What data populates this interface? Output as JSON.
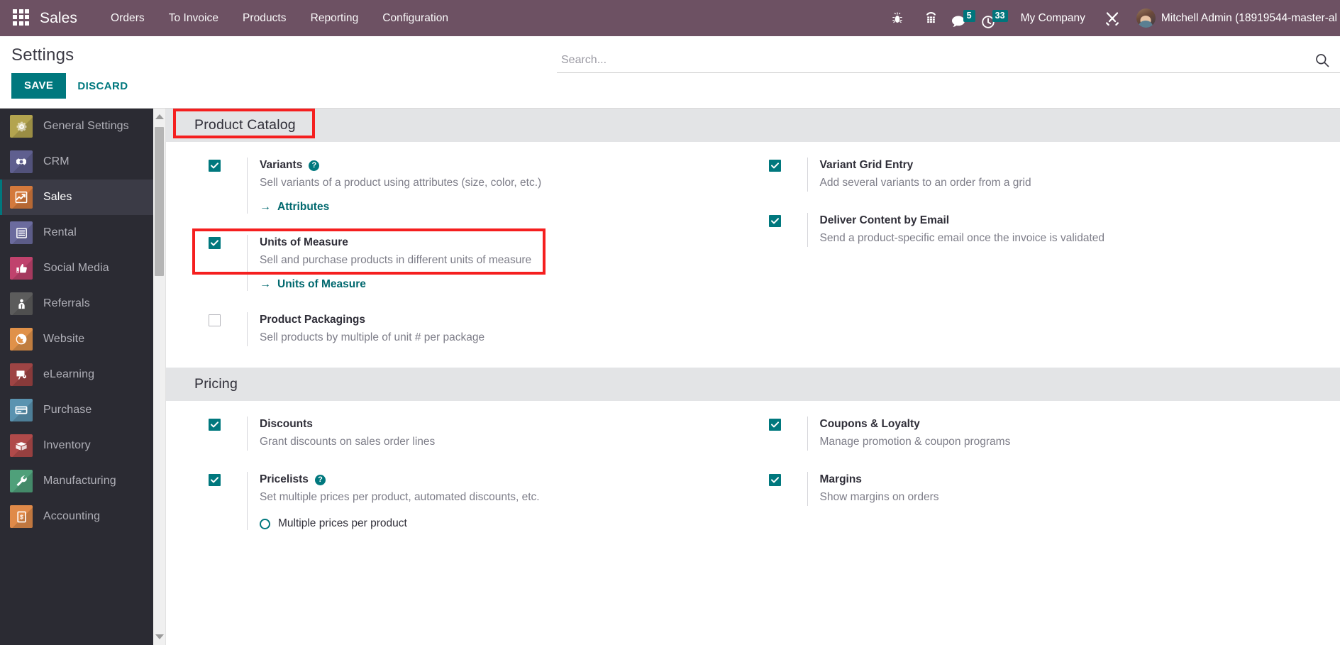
{
  "navbar": {
    "apps_icon": "apps-grid-icon",
    "brand": "Sales",
    "menu": [
      {
        "label": "Orders"
      },
      {
        "label": "To Invoice"
      },
      {
        "label": "Products"
      },
      {
        "label": "Reporting"
      },
      {
        "label": "Configuration"
      }
    ],
    "right": {
      "bug_icon": "bug-icon",
      "dialpad_icon": "dialpad-icon",
      "messages_icon": "chat-bubble-icon",
      "messages_count": "5",
      "activities_icon": "clock-icon",
      "activities_count": "33",
      "company": "My Company",
      "tools_icon": "tools-icon",
      "avatar": "user-avatar",
      "user": "Mitchell Admin (18919544-master-al"
    }
  },
  "control_panel": {
    "title": "Settings",
    "save_label": "SAVE",
    "discard_label": "DISCARD",
    "search_placeholder": "Search...",
    "search_value": "",
    "search_icon": "search-icon"
  },
  "sidebar": {
    "items": [
      {
        "label": "General Settings",
        "icon": "gear-icon",
        "color": "#b3a44f",
        "active": false
      },
      {
        "label": "CRM",
        "icon": "handshake-icon",
        "color": "#5f5f8f",
        "active": false
      },
      {
        "label": "Sales",
        "icon": "chart-line-up-icon",
        "color": "#d4793c",
        "active": true
      },
      {
        "label": "Rental",
        "icon": "document-list-icon",
        "color": "#6b6b9e",
        "active": false
      },
      {
        "label": "Social Media",
        "icon": "thumbs-up-icon",
        "color": "#c0426d",
        "active": false
      },
      {
        "label": "Referrals",
        "icon": "people-icon",
        "color": "#5c5c5c",
        "active": false
      },
      {
        "label": "Website",
        "icon": "globe-icon",
        "color": "#e09149",
        "active": false
      },
      {
        "label": "eLearning",
        "icon": "presentation-icon",
        "color": "#9e4444",
        "active": false
      },
      {
        "label": "Purchase",
        "icon": "credit-card-icon",
        "color": "#5a93b0",
        "active": false
      },
      {
        "label": "Inventory",
        "icon": "box-icon",
        "color": "#b04a4a",
        "active": false
      },
      {
        "label": "Manufacturing",
        "icon": "wrench-icon",
        "color": "#4fa07a",
        "active": false
      },
      {
        "label": "Accounting",
        "icon": "invoice-dollar-icon",
        "color": "#e08a49",
        "active": false
      }
    ]
  },
  "scrollbar": {
    "up_arrow": "triangle-up-icon",
    "down_arrow": "triangle-down-icon",
    "thumb": "scroll-thumb"
  },
  "sections": [
    {
      "title": "Product Catalog",
      "highlighted": true,
      "left": [
        {
          "label": "Variants",
          "has_help": true,
          "help_glyph": "?",
          "checked": true,
          "desc": "Sell variants of a product using attributes (size, color, etc.)",
          "link": "Attributes",
          "link_arrow": "→"
        },
        {
          "label": "Units of Measure",
          "has_help": false,
          "checked": true,
          "desc": "Sell and purchase products in different units of measure",
          "link": "Units of Measure",
          "link_arrow": "→",
          "highlighted": true
        },
        {
          "label": "Product Packagings",
          "has_help": false,
          "checked": false,
          "desc": "Sell products by multiple of unit # per package",
          "link": null
        }
      ],
      "right": [
        {
          "label": "Variant Grid Entry",
          "has_help": false,
          "checked": true,
          "desc": "Add several variants to an order from a grid",
          "link": null
        },
        {
          "label": "Deliver Content by Email",
          "has_help": false,
          "checked": true,
          "desc": "Send a product-specific email once the invoice is validated",
          "link": null
        }
      ]
    },
    {
      "title": "Pricing",
      "highlighted": false,
      "left": [
        {
          "label": "Discounts",
          "has_help": false,
          "checked": true,
          "desc": "Grant discounts on sales order lines",
          "link": null
        },
        {
          "label": "Pricelists",
          "has_help": true,
          "help_glyph": "?",
          "checked": true,
          "desc": "Set multiple prices per product, automated discounts, etc.",
          "link": null,
          "radio": "Multiple prices per product"
        }
      ],
      "right": [
        {
          "label": "Coupons & Loyalty",
          "has_help": false,
          "checked": true,
          "desc": "Manage promotion & coupon programs",
          "link": null
        },
        {
          "label": "Margins",
          "has_help": false,
          "checked": true,
          "desc": "Show margins on orders",
          "link": null
        }
      ]
    }
  ],
  "colors": {
    "navbar_bg": "#6d5163",
    "accent_teal": "#00787e",
    "sidebar_bg": "#2b2b33",
    "section_bg": "#e3e4e6",
    "annotation_red": "#f51f1f"
  }
}
